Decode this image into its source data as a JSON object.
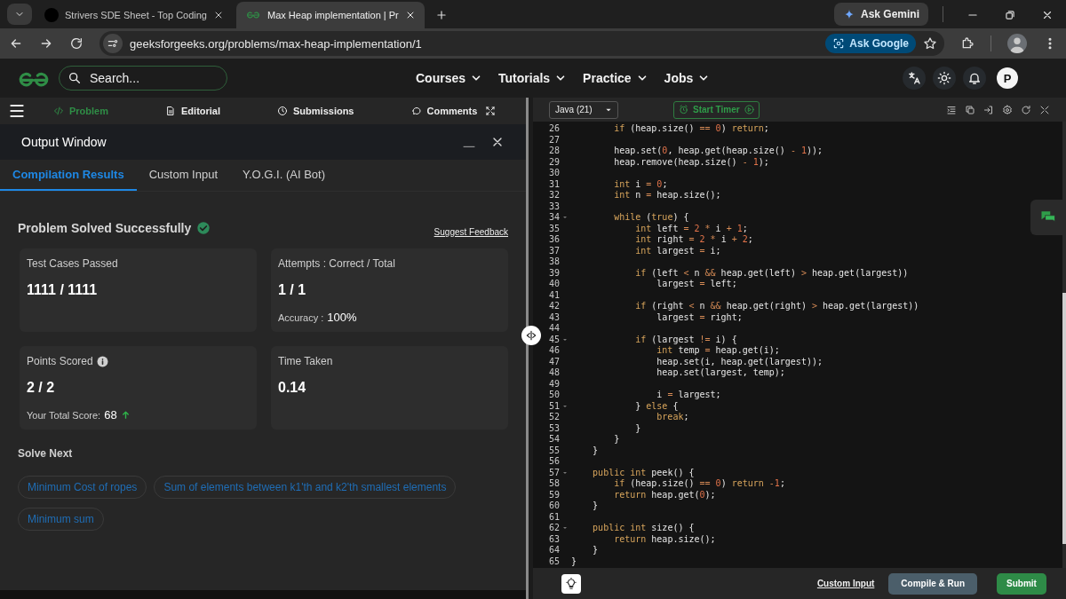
{
  "browser": {
    "tabs": [
      {
        "title": "Strivers SDE Sheet - Top Coding",
        "selected": false
      },
      {
        "title": "Max Heap implementation | Pr",
        "selected": true
      }
    ],
    "gemini_button": "Ask Gemini",
    "url": "geeksforgeeks.org/problems/max-heap-implementation/1",
    "ask_google_button": "Ask Google"
  },
  "site_header": {
    "search": {
      "placeholder": "Search..."
    },
    "nav": [
      "Courses",
      "Tutorials",
      "Practice",
      "Jobs"
    ],
    "avatar": "P"
  },
  "problem_tabs": [
    {
      "label": "Problem",
      "selected": true
    },
    {
      "label": "Editorial",
      "selected": false
    },
    {
      "label": "Submissions",
      "selected": false
    },
    {
      "label": "Comments",
      "selected": false
    }
  ],
  "output_window": {
    "title": "Output Window",
    "tabs": [
      {
        "label": "Compilation Results",
        "selected": true
      },
      {
        "label": "Custom Input",
        "selected": false
      },
      {
        "label": "Y.O.G.I. (AI Bot)",
        "selected": false
      }
    ],
    "status": "Problem Solved Successfully",
    "feedback_link": "Suggest Feedback",
    "cards": [
      {
        "kind": "plain",
        "label": "Test Cases Passed",
        "value": "1111 / 1111"
      },
      {
        "kind": "note",
        "label": "Attempts : Correct / Total",
        "value": "1 / 1",
        "note_label": "Accuracy :",
        "note_value": "100%"
      },
      {
        "kind": "score",
        "label": "Points Scored",
        "value": "2 / 2",
        "note_label": "Your Total Score:",
        "note_value": "68"
      },
      {
        "kind": "plain",
        "label": "Time Taken",
        "value": "0.14"
      }
    ],
    "solve_next": {
      "title": "Solve Next",
      "items": [
        "Minimum Cost of ropes",
        "Sum of elements between k1'th and k2'th smallest elements",
        "Minimum sum"
      ]
    }
  },
  "editor": {
    "language": "Java (21)",
    "timer_button": "Start Timer",
    "lines": [
      {
        "n": "26",
        "code": "        if (heap.size() == 0) return;",
        "fold": false
      },
      {
        "n": "27",
        "fold": false
      },
      {
        "n": "28",
        "code": "        heap.set(0, heap.get(heap.size() - 1));",
        "fold": false
      },
      {
        "n": "29",
        "code": "        heap.remove(heap.size() - 1);",
        "fold": false
      },
      {
        "n": "30",
        "fold": false
      },
      {
        "n": "31",
        "code": "        int i = 0;",
        "fold": false
      },
      {
        "n": "32",
        "code": "        int n = heap.size();",
        "fold": false
      },
      {
        "n": "33",
        "fold": false
      },
      {
        "n": "34",
        "code": "        while (true) {",
        "fold": true
      },
      {
        "n": "35",
        "code": "            int left = 2 * i + 1;",
        "fold": false
      },
      {
        "n": "36",
        "code": "            int right = 2 * i + 2;",
        "fold": false
      },
      {
        "n": "37",
        "code": "            int largest = i;",
        "fold": false
      },
      {
        "n": "38",
        "fold": false
      },
      {
        "n": "39",
        "code": "            if (left < n && heap.get(left) > heap.get(largest))",
        "fold": false
      },
      {
        "n": "40",
        "code": "                largest = left;",
        "fold": false
      },
      {
        "n": "41",
        "fold": false
      },
      {
        "n": "42",
        "code": "            if (right < n && heap.get(right) > heap.get(largest))",
        "fold": false
      },
      {
        "n": "43",
        "code": "                largest = right;",
        "fold": false
      },
      {
        "n": "44",
        "fold": false
      },
      {
        "n": "45",
        "code": "            if (largest != i) {",
        "fold": true
      },
      {
        "n": "46",
        "code": "                int temp = heap.get(i);",
        "fold": false
      },
      {
        "n": "47",
        "code": "                heap.set(i, heap.get(largest));",
        "fold": false
      },
      {
        "n": "48",
        "code": "                heap.set(largest, temp);",
        "fold": false
      },
      {
        "n": "49",
        "fold": false
      },
      {
        "n": "50",
        "code": "                i = largest;",
        "fold": false
      },
      {
        "n": "51",
        "code": "            } else {",
        "fold": true
      },
      {
        "n": "52",
        "code": "                break;",
        "fold": false
      },
      {
        "n": "53",
        "code": "            }",
        "fold": false
      },
      {
        "n": "54",
        "code": "        }",
        "fold": false
      },
      {
        "n": "55",
        "code": "    }",
        "fold": false
      },
      {
        "n": "56",
        "fold": false
      },
      {
        "n": "57",
        "code": "    public int peek() {",
        "fold": true
      },
      {
        "n": "58",
        "code": "        if (heap.size() == 0) return -1;",
        "fold": false
      },
      {
        "n": "59",
        "code": "        return heap.get(0);",
        "fold": false
      },
      {
        "n": "60",
        "code": "    }",
        "fold": false
      },
      {
        "n": "61",
        "fold": false
      },
      {
        "n": "62",
        "code": "    public int size() {",
        "fold": true
      },
      {
        "n": "63",
        "code": "        return heap.size();",
        "fold": false
      },
      {
        "n": "64",
        "code": "    }",
        "fold": false
      },
      {
        "n": "65",
        "code": "}",
        "fold": false
      }
    ],
    "custom_input_link": "Custom Input",
    "compile_button": "Compile & Run",
    "submit_button": "Submit"
  }
}
